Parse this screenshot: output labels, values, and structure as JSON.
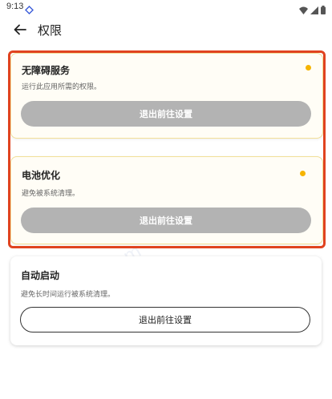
{
  "status_bar": {
    "time": "9:13"
  },
  "header": {
    "title": "权限"
  },
  "permissions": [
    {
      "title": "无障碍服务",
      "description": "运行此应用所需的权限。",
      "button_label": "退出前往设置",
      "status_color": "#f6b400"
    },
    {
      "title": "电池优化",
      "description": "避免被系统清理。",
      "button_label": "退出前往设置",
      "status_color": "#f6b400"
    },
    {
      "title": "自动启动",
      "description": "避免长时间运行被系统清理。",
      "button_label": "退出前往设置"
    }
  ],
  "watermark": "mfunz.com",
  "colors": {
    "highlight_border": "#e0431f",
    "warning_dot": "#f6b400",
    "disabled_button": "#b3b3b3"
  }
}
